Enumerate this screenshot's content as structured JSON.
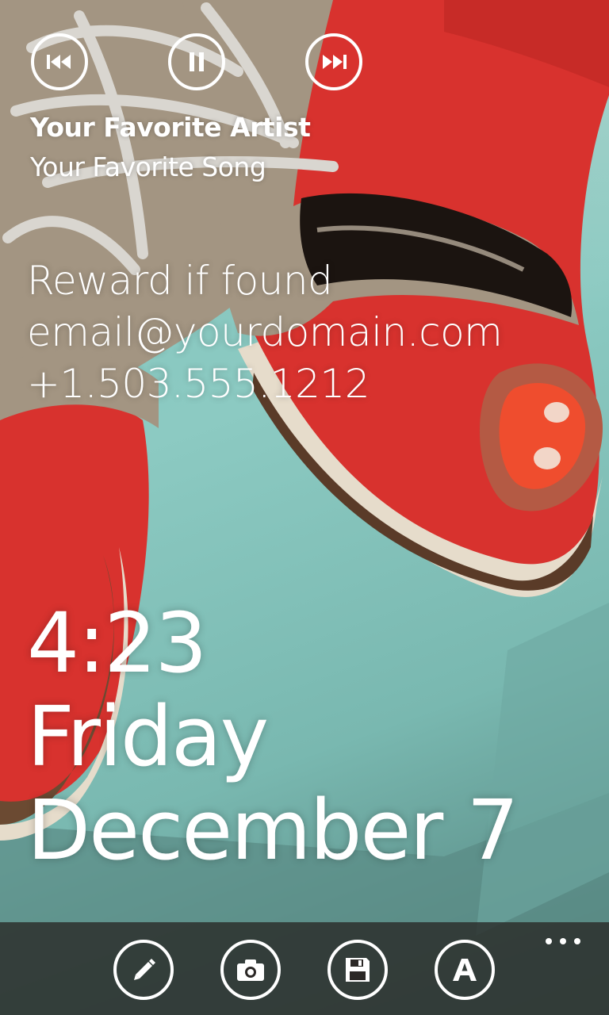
{
  "media": {
    "artist": "Your Favorite Artist",
    "song": "Your Favorite Song",
    "prev_icon": "skip-previous-icon",
    "pause_icon": "pause-icon",
    "next_icon": "skip-next-icon"
  },
  "message": {
    "line1": "Reward if found",
    "line2": "email@yourdomain.com",
    "line3": "+1.503.555.1212"
  },
  "clock": {
    "time": "4:23",
    "day": "Friday",
    "date": "December 7"
  },
  "app_bar": {
    "buttons": [
      {
        "icon": "pencil-icon"
      },
      {
        "icon": "camera-icon"
      },
      {
        "icon": "floppy-disk-icon"
      },
      {
        "icon": "font-letter-icon"
      }
    ],
    "more_icon": "ellipsis-icon"
  },
  "colors": {
    "text": "#ffffff",
    "shoe_red": "#d8322e",
    "shoe_tan": "#a39582",
    "table_teal": "#86c6bf",
    "app_bar": "#282624"
  }
}
